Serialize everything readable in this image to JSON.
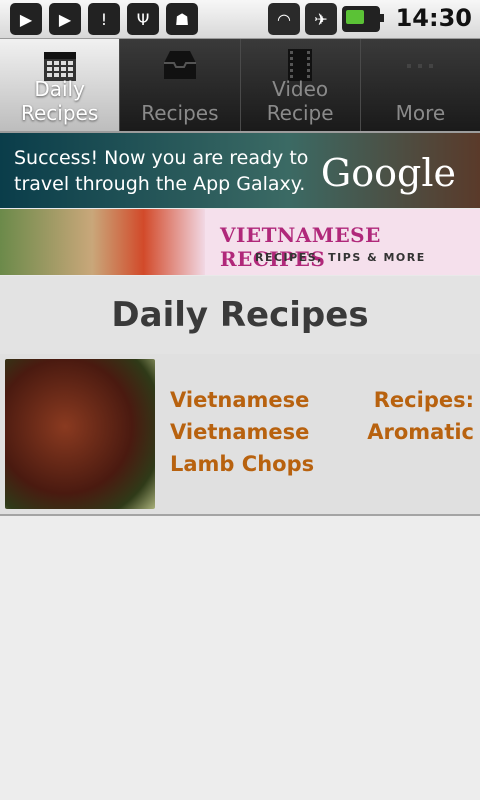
{
  "status_bar": {
    "time": "14:30"
  },
  "tabs": [
    {
      "label": "Daily Recipes",
      "icon": "calendar-icon",
      "active": true
    },
    {
      "label": "Recipes",
      "icon": "inbox-icon",
      "active": false
    },
    {
      "label": "Video Recipe",
      "icon": "film-icon",
      "active": false
    },
    {
      "label": "More",
      "icon": "more-dots-icon",
      "active": false
    }
  ],
  "ad": {
    "message_line1": "Success! Now you are ready to",
    "message_line2": "travel through the App Galaxy.",
    "brand": "Google"
  },
  "hero": {
    "title": "VIETNAMESE RECIPES",
    "subtitle": "RECIPES, TIPS & MORE"
  },
  "section": {
    "title": "Daily Recipes"
  },
  "recipes": [
    {
      "title": "Vietnamese Recipes: Vietnamese Aromatic Lamb Chops"
    }
  ]
}
